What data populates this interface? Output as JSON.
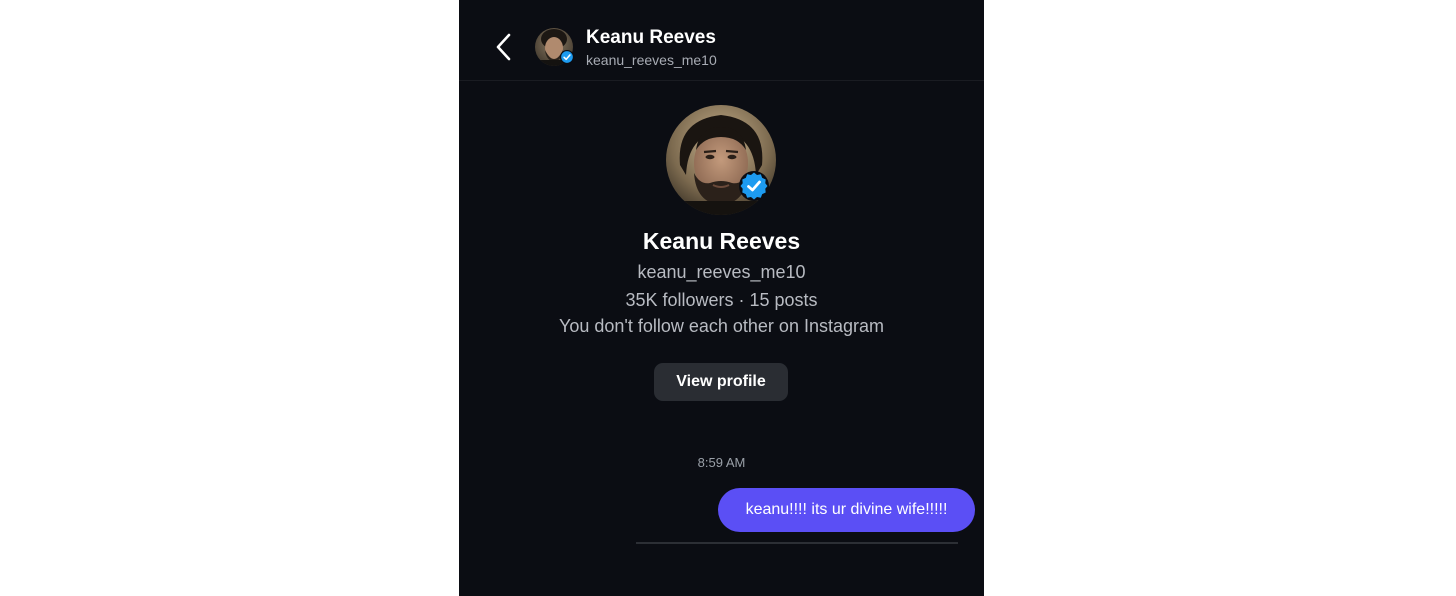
{
  "header": {
    "name": "Keanu Reeves",
    "username": "keanu_reeves_me10"
  },
  "profile": {
    "name": "Keanu Reeves",
    "username": "keanu_reeves_me10",
    "stats": "35K followers · 15 posts",
    "follow_status": "You don't follow each other on Instagram",
    "view_profile_label": "View profile"
  },
  "messages": {
    "timestamp": "8:59 AM",
    "items": [
      {
        "text": "keanu!!!! its ur divine wife!!!!!",
        "sender": "me"
      }
    ]
  },
  "colors": {
    "background": "#0b0d13",
    "bubble": "#5b4ff5",
    "verified": "#1d9bf0",
    "button": "#2a2d33"
  },
  "icons": {
    "back": "chevron-left-icon",
    "verified": "verified-badge-icon"
  }
}
